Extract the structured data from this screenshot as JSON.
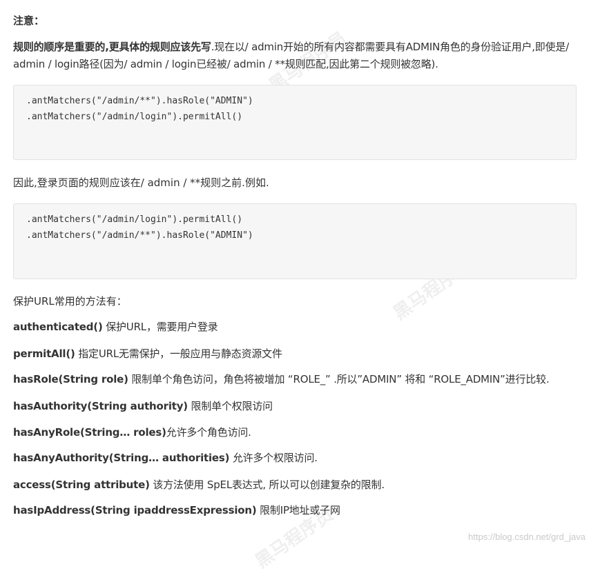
{
  "note_title": "注意：",
  "intro": {
    "bold": "规则的顺序是重要的,更具体的规则应该先写",
    "rest": ".现在以/ admin开始的所有内容都需要具有ADMIN角色的身份验证用户,即使是/ admin / login路径(因为/ admin / login已经被/ admin / **规则匹配,因此第二个规则被忽略)."
  },
  "code_block_1": [
    ".antMatchers(\"/admin/**\").hasRole(\"ADMIN\")",
    ".antMatchers(\"/admin/login\").permitAll()"
  ],
  "hence_text": "因此,登录页面的规则应该在/ admin / **规则之前.例如.",
  "code_block_2": [
    ".antMatchers(\"/admin/login\").permitAll()",
    ".antMatchers(\"/admin/**\").hasRole(\"ADMIN\")"
  ],
  "methods_heading": "保护URL常用的方法有：",
  "methods": [
    {
      "name": "authenticated()",
      "desc": " 保护URL，需要用户登录"
    },
    {
      "name": "permitAll()",
      "desc": " 指定URL无需保护，一般应用与静态资源文件"
    },
    {
      "name": "hasRole(String role)",
      "desc": " 限制单个角色访问，角色将被增加 “ROLE_” .所以”ADMIN” 将和 “ROLE_ADMIN”进行比较."
    },
    {
      "name": "hasAuthority(String authority)",
      "desc": " 限制单个权限访问"
    },
    {
      "name": "hasAnyRole(String… roles)",
      "desc": "允许多个角色访问."
    },
    {
      "name": "hasAnyAuthority(String… authorities)",
      "desc": " 允许多个权限访问."
    },
    {
      "name": "access(String attribute)",
      "desc": " 该方法使用 SpEL表达式, 所以可以创建复杂的限制."
    },
    {
      "name": "hasIpAddress(String ipaddressExpression)",
      "desc": " 限制IP地址或子网"
    }
  ],
  "watermark": "https://blog.csdn.net/grd_java",
  "brand_watermark": "黑马程序员"
}
